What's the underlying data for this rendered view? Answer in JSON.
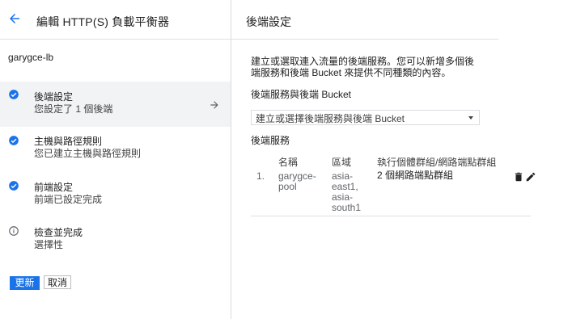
{
  "left_panel": {
    "title": "編輯 HTTP(S) 負載平衡器",
    "lb_name": "garygce-lb",
    "steps": [
      {
        "title": "後端設定",
        "subtitle": "您設定了 1 個後端",
        "icon": "check-circle-icon",
        "active": true
      },
      {
        "title": "主機與路徑規則",
        "subtitle": "您已建立主機與路徑規則",
        "icon": "check-circle-icon",
        "active": false
      },
      {
        "title": "前端設定",
        "subtitle": "前端已設定完成",
        "icon": "check-circle-icon",
        "active": false
      },
      {
        "title": "檢查並完成",
        "subtitle": "選擇性",
        "icon": "info-icon",
        "active": false
      }
    ],
    "update_label": "更新",
    "cancel_label": "取消"
  },
  "right_panel": {
    "title": "後端設定",
    "description_line1": "建立或選取連入流量的後端服務。您可以新增多個後",
    "description_line2": "端服務和後端 Bucket 來提供不同種類的內容。",
    "backend_label": "後端服務與後端 Bucket",
    "select_placeholder": "建立或選擇後端服務與後端 Bucket",
    "services_label": "後端服務",
    "table": {
      "headers": [
        "名稱",
        "區域",
        "執行個體群組/網路端點群組"
      ],
      "rows": [
        {
          "index": "1.",
          "name_line1": "garygce-",
          "name_line2": "pool",
          "region_line1": "asia-",
          "region_line2": "east1,",
          "region_line3": "asia-",
          "region_line4": "south1",
          "groups": "2 個網路端點群組"
        }
      ]
    }
  },
  "colors": {
    "accent": "#1a73e8",
    "check": "#1a73e8",
    "active_bg": "#f1f3f4"
  }
}
